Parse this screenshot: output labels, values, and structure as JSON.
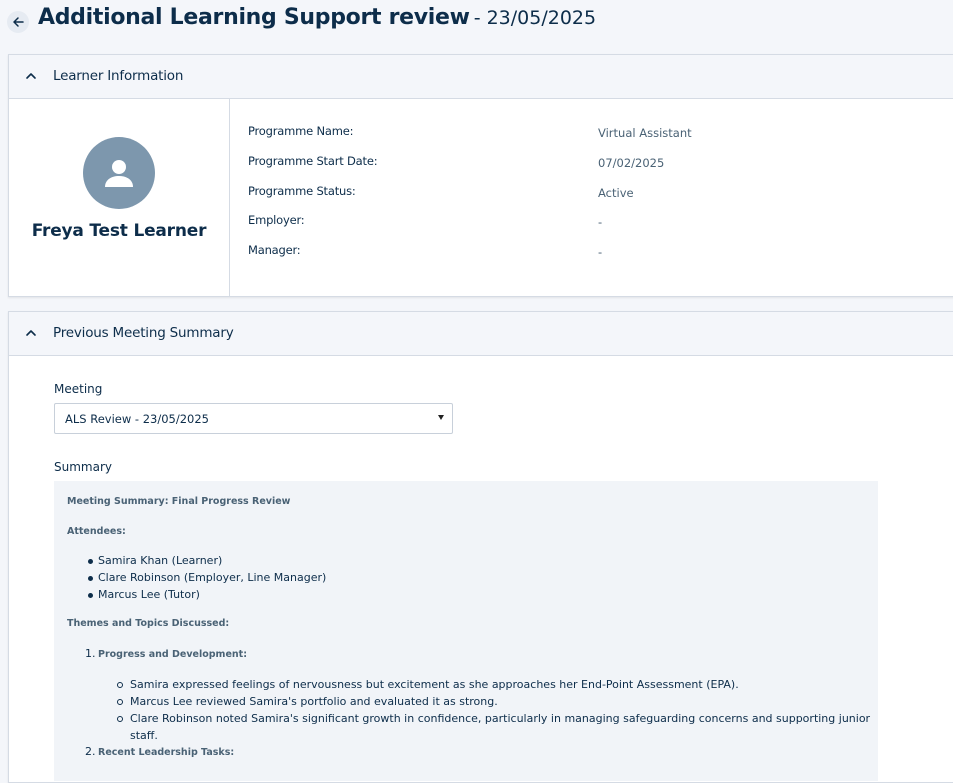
{
  "header": {
    "title": "Additional Learning Support review",
    "date": "- 23/05/2025"
  },
  "icons": {
    "back": "arrow-left-icon",
    "collapse": "chevron-up-icon",
    "avatar": "person-icon",
    "dropdown": "caret-down-icon"
  },
  "colors": {
    "primary_text": "#0d2d4a",
    "secondary_text": "#4a6275",
    "avatar_bg": "#7d97ad",
    "panel_bg": "#f4f6fa"
  },
  "learner_section": {
    "title": "Learner Information",
    "name": "Freya Test Learner",
    "fields": [
      {
        "label": "Programme Name:",
        "value": "Virtual Assistant"
      },
      {
        "label": "Programme Start Date:",
        "value": "07/02/2025"
      },
      {
        "label": "Programme Status:",
        "value": "Active"
      },
      {
        "label": "Employer:",
        "value": "-"
      },
      {
        "label": "Manager:",
        "value": "-"
      }
    ]
  },
  "meeting_section": {
    "title": "Previous Meeting Summary",
    "meeting_label": "Meeting",
    "meeting_selected": "ALS Review - 23/05/2025",
    "summary_label": "Summary",
    "summary": {
      "heading": "Meeting Summary: Final Progress Review",
      "attendees_heading": "Attendees:",
      "attendees": [
        "Samira Khan (Learner)",
        "Clare Robinson (Employer, Line Manager)",
        "Marcus Lee (Tutor)"
      ],
      "themes_heading": "Themes and Topics Discussed:",
      "themes": [
        {
          "number": "1.",
          "title": "Progress and Development:",
          "points": [
            "Samira expressed feelings of nervousness but excitement as she approaches her End-Point Assessment (EPA).",
            "Marcus Lee reviewed Samira's portfolio and evaluated it as strong.",
            "Clare Robinson noted Samira's significant growth in confidence, particularly in managing safeguarding concerns and supporting junior",
            "staff."
          ]
        },
        {
          "number": "2.",
          "title": "Recent Leadership Tasks:"
        }
      ]
    }
  }
}
